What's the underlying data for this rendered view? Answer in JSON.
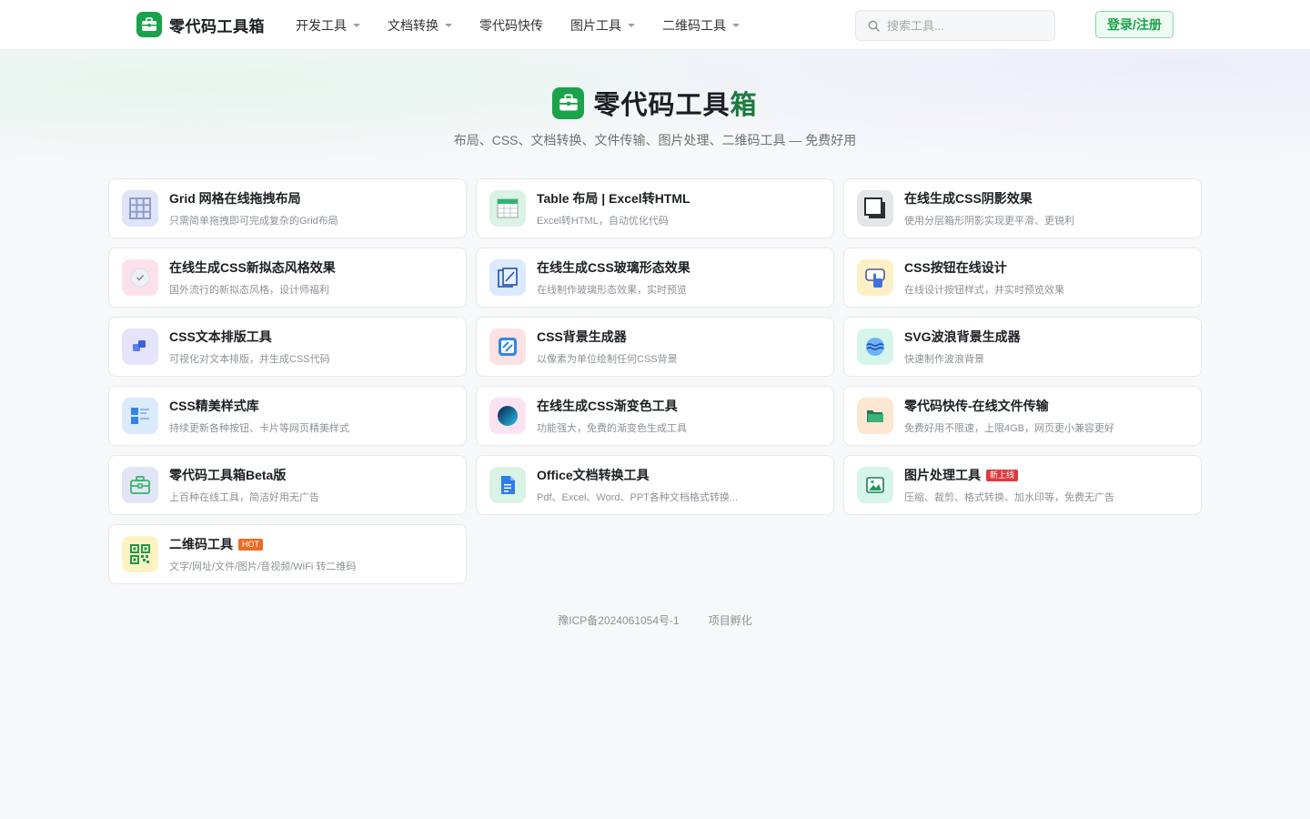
{
  "brand": {
    "name": "零代码工具箱",
    "logo_icon": "toolbox-icon",
    "color": "#1aa34a"
  },
  "nav": [
    {
      "label": "开发工具",
      "has_dropdown": true
    },
    {
      "label": "文档转换",
      "has_dropdown": true
    },
    {
      "label": "零代码快传",
      "has_dropdown": false
    },
    {
      "label": "图片工具",
      "has_dropdown": true
    },
    {
      "label": "二维码工具",
      "has_dropdown": true
    }
  ],
  "search": {
    "placeholder": "搜索工具...",
    "icon": "search-icon"
  },
  "login": {
    "label": "登录/注册"
  },
  "hero": {
    "title_a": "零代码工具",
    "title_b": "箱",
    "subtitle": "布局、CSS、文档转换、文件传输、图片处理、二维码工具 — 免费好用"
  },
  "tools": [
    {
      "title": "Grid 网格在线拖拽布局",
      "desc": "只需简单拖拽即可完成复杂的Grid布局",
      "icon": "grid-icon",
      "bg": "#dfe4f6"
    },
    {
      "title": "Table 布局 | Excel转HTML",
      "desc": "Excel转HTML，自动优化代码",
      "icon": "table-icon",
      "bg": "#d9f3e6"
    },
    {
      "title": "在线生成CSS阴影效果",
      "desc": "使用分层箱形阴影实现更平滑、更锐利",
      "icon": "shadow-box-icon",
      "bg": "#e4e6ea"
    },
    {
      "title": "在线生成CSS新拟态风格效果",
      "desc": "国外流行的新拟态风格，设计师福利",
      "icon": "neumorphism-icon",
      "bg": "#fde1ea"
    },
    {
      "title": "在线生成CSS玻璃形态效果",
      "desc": "在线制作玻璃形态效果，实时预览",
      "icon": "glass-edit-icon",
      "bg": "#dbeafe"
    },
    {
      "title": "CSS按钮在线设计",
      "desc": "在线设计按钮样式，并实时预览效果",
      "icon": "button-click-icon",
      "bg": "#fdf0c7"
    },
    {
      "title": "CSS文本排版工具",
      "desc": "可视化对文本排版，并生成CSS代码",
      "icon": "text-layout-icon",
      "bg": "#e6e4fb"
    },
    {
      "title": "CSS背景生成器",
      "desc": "以像素为单位绘制任何CSS背景",
      "icon": "pattern-icon",
      "bg": "#fde2e4"
    },
    {
      "title": "SVG波浪背景生成器",
      "desc": "快速制作波浪背景",
      "icon": "wave-icon",
      "bg": "#d6f5ec"
    },
    {
      "title": "CSS精美样式库",
      "desc": "持续更新各种按钮、卡片等网页精美样式",
      "icon": "style-library-icon",
      "bg": "#dceafd"
    },
    {
      "title": "在线生成CSS渐变色工具",
      "desc": "功能强大，免费的渐变色生成工具",
      "icon": "gradient-icon",
      "bg": "#fbe3f3"
    },
    {
      "title": "零代码快传-在线文件传输",
      "desc": "免费好用不限速，上限4GB，网页更小兼容更好",
      "icon": "folder-icon",
      "bg": "#fde7d3"
    },
    {
      "title": "零代码工具箱Beta版",
      "desc": "上百种在线工具，简洁好用无广告",
      "icon": "toolbox-icon",
      "bg": "#e2e5f6"
    },
    {
      "title": "Office文档转换工具",
      "desc": "Pdf、Excel、Word、PPT各种文档格式转换...",
      "icon": "document-icon",
      "bg": "#d9f3e6"
    },
    {
      "title": "图片处理工具",
      "desc": "压缩、裁剪、格式转换、加水印等，免费无广告",
      "icon": "image-icon",
      "bg": "#d6f5ec",
      "tag": "新上线",
      "tag_color": "#e0393e"
    },
    {
      "title": "二维码工具",
      "desc": "文字/网址/文件/图片/音视频/WiFi 转二维码",
      "icon": "qr-code-icon",
      "bg": "#fdf3c2",
      "tag": "HOT",
      "tag_color": "#ef6b22"
    }
  ],
  "footer": {
    "icp": "豫ICP备2024061054号-1",
    "incubation": "项目孵化"
  }
}
